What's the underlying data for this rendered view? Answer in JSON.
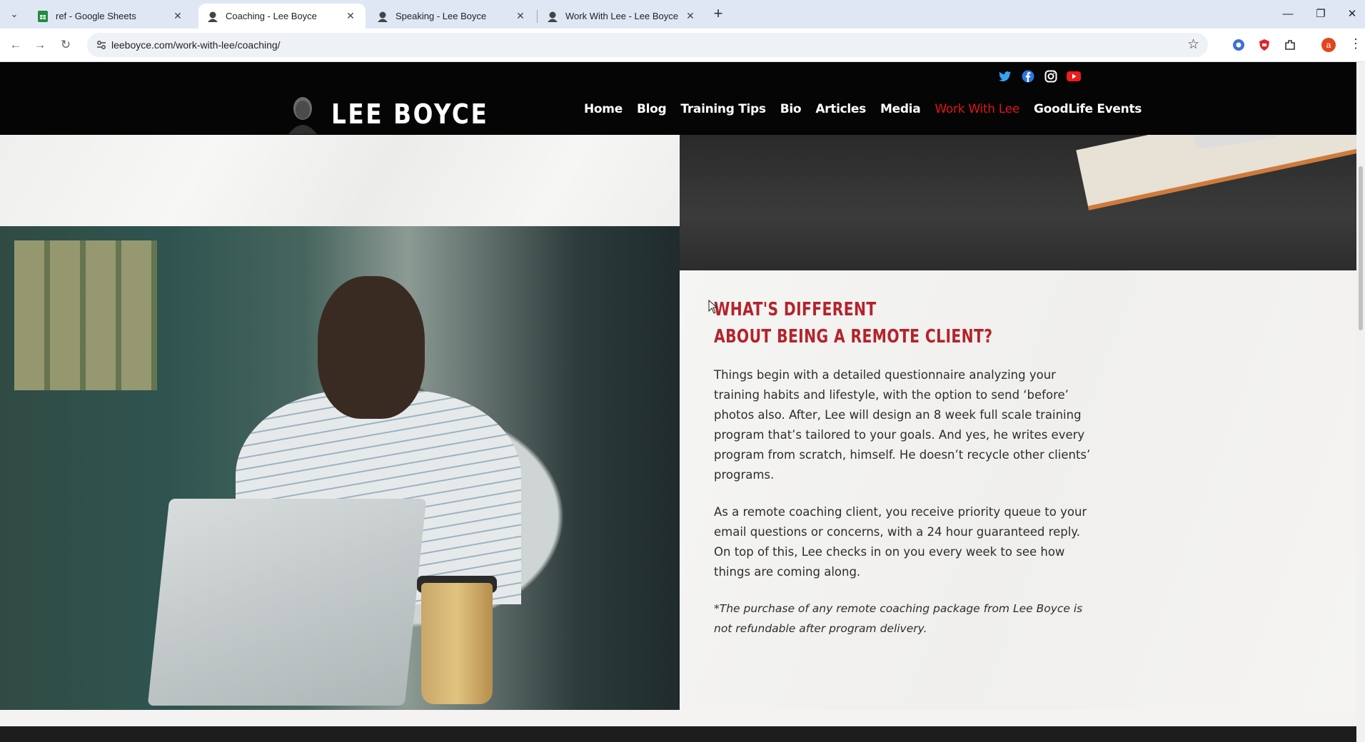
{
  "browser": {
    "tabs": [
      {
        "title": "ref - Google Sheets",
        "icon": "google-sheets-icon",
        "active": false
      },
      {
        "title": "Coaching - Lee Boyce",
        "icon": "lee-boyce-favicon",
        "active": true
      },
      {
        "title": "Speaking - Lee Boyce",
        "icon": "lee-boyce-favicon",
        "active": false
      },
      {
        "title": "Work With Lee - Lee Boyce",
        "icon": "lee-boyce-favicon",
        "active": false
      }
    ],
    "url": "leeboyce.com/work-with-lee/coaching/",
    "profile_initial": "a",
    "colors": {
      "tabbar": "#dfe7f5",
      "profile": "#e0471c"
    }
  },
  "site": {
    "logo_text": "LEE BOYCE",
    "social": [
      "twitter-icon",
      "facebook-icon",
      "instagram-icon",
      "youtube-icon"
    ],
    "nav": [
      {
        "label": "Home",
        "active": false
      },
      {
        "label": "Blog",
        "active": false
      },
      {
        "label": "Training Tips",
        "active": false
      },
      {
        "label": "Bio",
        "active": false
      },
      {
        "label": "Articles",
        "active": false
      },
      {
        "label": "Media",
        "active": false
      },
      {
        "label": "Work With Lee",
        "active": true
      },
      {
        "label": "GoodLife Events",
        "active": false
      }
    ],
    "colors": {
      "accent": "#e01418",
      "heading": "#b4232b",
      "header_bg": "#050505"
    }
  },
  "section": {
    "heading_line1": "WHAT'S DIFFERENT",
    "heading_line2": "ABOUT BEING A REMOTE CLIENT?",
    "paragraph1": "Things begin with a detailed questionnaire analyzing your training habits and lifestyle, with the option to send ‘before’ photos also. After, Lee will design an 8 week full scale training program that’s tailored to your goals. And yes, he writes every program from scratch, himself. He doesn’t recycle other clients’ programs.",
    "paragraph2": "As a remote coaching client, you receive priority queue to your email questions or concerns, with a 24 hour guaranteed reply. On top of this, Lee checks in on you every week to see how things are coming along.",
    "note": "*The purchase of any remote coaching package from Lee Boyce is not refundable after program delivery."
  }
}
